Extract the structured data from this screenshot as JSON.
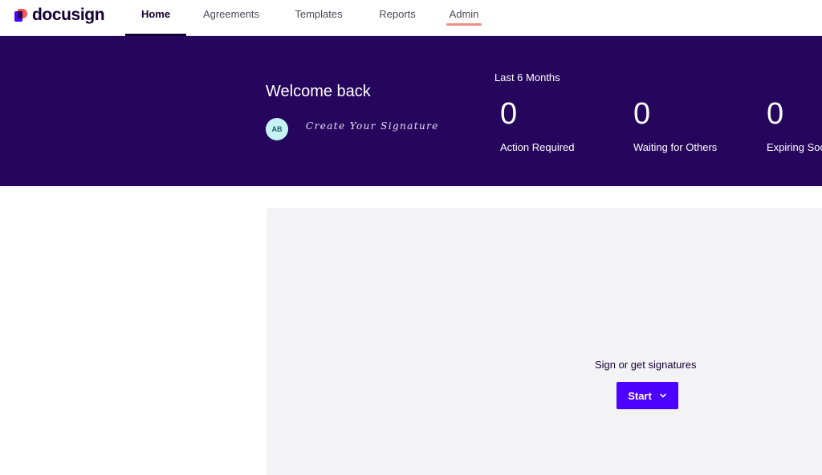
{
  "brand": {
    "name": "docusign",
    "colors": {
      "primary": "#4c00ff",
      "hero": "#26065d",
      "accent": "#ff5252"
    }
  },
  "nav": {
    "tabs": [
      {
        "label": "Home",
        "active": true
      },
      {
        "label": "Agreements",
        "active": false
      },
      {
        "label": "Templates",
        "active": false
      },
      {
        "label": "Reports",
        "active": false
      },
      {
        "label": "Admin",
        "active": false
      }
    ]
  },
  "hero": {
    "welcome": "Welcome back",
    "avatar_initials": "AB",
    "signature_prompt": "Create Your Signature",
    "period_label": "Last 6 Months",
    "stats": [
      {
        "value": "0",
        "label": "Action Required"
      },
      {
        "value": "0",
        "label": "Waiting for Others"
      },
      {
        "value": "0",
        "label": "Expiring Soon"
      }
    ]
  },
  "main": {
    "title": "Sign or get signatures",
    "start_label": "Start",
    "start_icon": "chevron-down-icon"
  }
}
